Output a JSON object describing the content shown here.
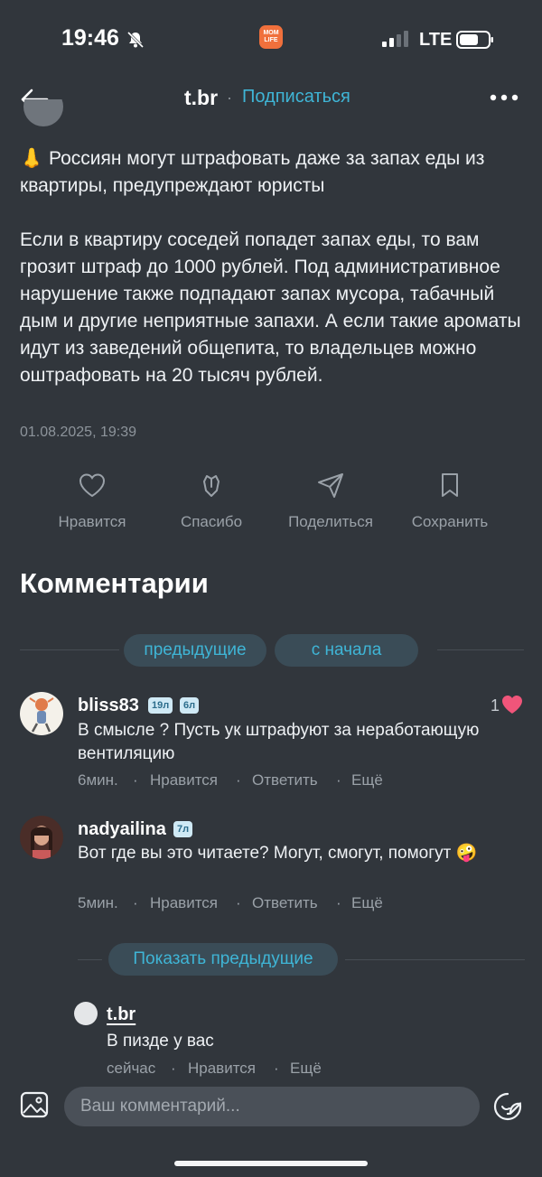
{
  "status_bar": {
    "time": "19:46",
    "network": "LTE",
    "app_badge": "MOM LIFE"
  },
  "header": {
    "title": "t.br",
    "separator": "·",
    "subscribe": "Подписаться"
  },
  "post": {
    "text": "👃 Россиян могут штрафовать даже за запах еды из квартиры, предупреждают юристы\n\nЕсли в квартиру соседей попадет запах еды, то вам грозит штраф до 1000 рублей. Под административное нарушение также подпадают запах мусора, табачный дым и другие неприятные запахи. А если такие ароматы идут из заведений общепита, то владельцев можно оштрафовать на 20 тысяч рублей.",
    "date": "01.08.2025, 19:39"
  },
  "actions": {
    "like": "Нравится",
    "thanks": "Спасибо",
    "share": "Поделиться",
    "save": "Сохранить"
  },
  "comments": {
    "title": "Комментарии",
    "prev_button": "предыдущие",
    "start_button": "с начала",
    "show_prev_button": "Показать предыдущие",
    "items": [
      {
        "user": "bliss83",
        "badges": [
          "19л",
          "6л"
        ],
        "text": "В смысле ? Пусть ук штрафуют за неработающую вентиляцию",
        "time": "6мин.",
        "like": "Нравится",
        "reply": "Ответить",
        "more": "Ещё",
        "likes_count": "1"
      },
      {
        "user": "nadyailina",
        "badges": [
          "7л"
        ],
        "text": "Вот где вы это читаете? Могут, смогут, помогут 🤪",
        "time": "5мин.",
        "like": "Нравится",
        "reply": "Ответить",
        "more": "Ещё"
      }
    ],
    "reply": {
      "user": "t.br",
      "text": "В пизде у вас",
      "time": "сейчас",
      "like": "Нравится",
      "more": "Ещё"
    }
  },
  "composer": {
    "placeholder": "Ваш комментарий..."
  },
  "colors": {
    "background": "#31363c",
    "accent": "#3fb5d6",
    "heart": "#f0557a"
  }
}
